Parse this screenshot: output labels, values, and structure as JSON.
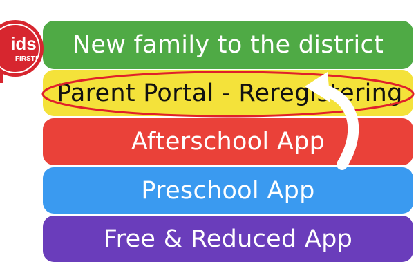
{
  "menu": {
    "items": [
      {
        "label": "New family to the district",
        "bg": "#4faa45",
        "fg": "#ffffff"
      },
      {
        "label": "Parent Portal - Reregistering",
        "bg": "#f4e23a",
        "fg": "#111111"
      },
      {
        "label": "Afterschool App",
        "bg": "#ea4139",
        "fg": "#ffffff"
      },
      {
        "label": "Preschool App",
        "bg": "#3a9af0",
        "fg": "#ffffff"
      },
      {
        "label": "Free & Reduced App",
        "bg": "#6a3dbb",
        "fg": "#ffffff"
      }
    ]
  },
  "badge": {
    "text_main": "ids",
    "text_sub": "FIRST!",
    "color": "#d7262f"
  },
  "annotation": {
    "circle_color": "#e0202a",
    "arrow_color": "#ffffff"
  },
  "icons": [
    "kids-first-logo",
    "red-ellipse-highlight",
    "curved-arrow-icon"
  ]
}
